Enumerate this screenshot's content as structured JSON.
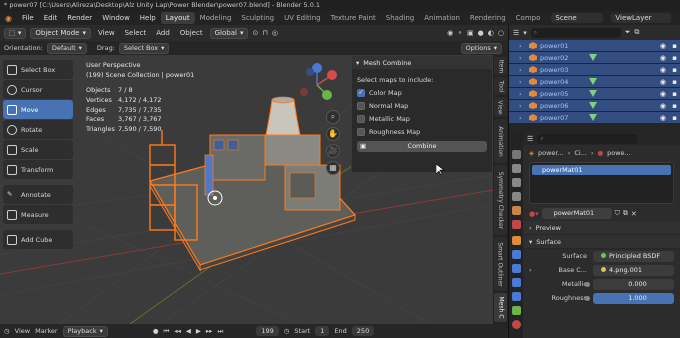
{
  "window": {
    "title": "* power07 [C:\\Users\\Alireza\\Desktop\\Alz Unity Lap\\Power Blender\\power07.blend] - Blender 5.0.1"
  },
  "menu": {
    "items": [
      "File",
      "Edit",
      "Render",
      "Window",
      "Help"
    ],
    "workspaces": [
      "Layout",
      "Modeling",
      "Sculpting",
      "UV Editing",
      "Texture Paint",
      "Shading",
      "Animation",
      "Rendering",
      "Compo"
    ],
    "active_workspace": "Layout",
    "scene": "Scene",
    "view_layer": "ViewLayer"
  },
  "viewport_header": {
    "mode": "Object Mode",
    "view": "View",
    "select": "Select",
    "add": "Add",
    "object": "Object",
    "transform": "Global"
  },
  "tool_settings": {
    "orientation_label": "Orientation:",
    "orientation_value": "Default",
    "drag_label": "Drag:",
    "drag_value": "Select Box",
    "options": "Options"
  },
  "toolbar": {
    "tools": [
      "Select Box",
      "Cursor",
      "Move",
      "Rotate",
      "Scale",
      "Transform",
      "Annotate",
      "Measure",
      "Add Cube"
    ],
    "active": "Move"
  },
  "viewport_info": {
    "view_name": "User Perspective",
    "collection": "(199) Scene Collection | power01",
    "stats": [
      {
        "label": "Objects",
        "value": "7 / 8"
      },
      {
        "label": "Vertices",
        "value": "4,172 / 4,172"
      },
      {
        "label": "Edges",
        "value": "7,735 / 7,735"
      },
      {
        "label": "Faces",
        "value": "3,767 / 3,767"
      },
      {
        "label": "Triangles",
        "value": "7,590 / 7,590"
      }
    ]
  },
  "mesh_combine_panel": {
    "title": "Mesh Combine",
    "prompt": "Select maps to include:",
    "options": [
      {
        "label": "Color Map",
        "checked": true
      },
      {
        "label": "Normal Map",
        "checked": false
      },
      {
        "label": "Metallic Map",
        "checked": false
      },
      {
        "label": "Roughness Map",
        "checked": false
      }
    ],
    "button": "Combine"
  },
  "sidebar_tabs": [
    "Item",
    "Tool",
    "View",
    "Animation",
    "Symmetry Checker",
    "Smart Outliner",
    "Mesh C"
  ],
  "timeline": {
    "view": "View",
    "marker": "Marker",
    "playback": "Playback",
    "current_frame": "199",
    "start_label": "Start",
    "start": "1",
    "end_label": "End",
    "end": "250"
  },
  "outliner": {
    "items": [
      "power01",
      "power02",
      "power03",
      "power04",
      "power05",
      "power06",
      "power07"
    ]
  },
  "properties": {
    "breadcrumb_object": "power...",
    "breadcrumb_mid": "Ci...",
    "breadcrumb_mat": "powe...",
    "slot": "powerMat01",
    "material_name": "powerMat01",
    "sections": {
      "preview": "Preview",
      "surface": "Surface"
    },
    "surface": {
      "label": "Surface",
      "value": "Principled BSDF"
    },
    "base_color": {
      "label": "Base C...",
      "value": "4.png.001"
    },
    "metallic": {
      "label": "Metallic",
      "value": "0.000"
    },
    "roughness": {
      "label": "Roughness",
      "value": "1.000"
    }
  },
  "colors": {
    "accent": "#4772b3",
    "selection_outline": "#ff7a1a",
    "outliner_selected": "#334d80"
  }
}
